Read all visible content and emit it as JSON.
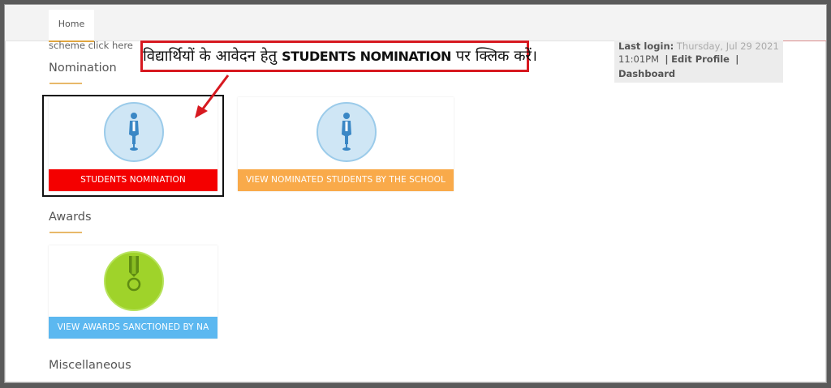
{
  "topbar": {
    "home_tab": "Home"
  },
  "scheme_text": "scheme click here",
  "sections": {
    "nomination": "Nomination",
    "awards": "Awards",
    "misc": "Miscellaneous"
  },
  "cards": {
    "students_nomination": "STUDENTS NOMINATION",
    "view_nominated": "VIEW NOMINATED STUDENTS BY THE SCHOOL",
    "view_awards": "VIEW AWARDS SANCTIONED BY NA"
  },
  "sidebar": {
    "last_login_label": "Last login:",
    "last_login_date": "Thursday, Jul 29 2021",
    "last_login_time": "11:01PM",
    "sep1": "|",
    "edit_profile": "Edit Profile",
    "sep2": "|",
    "dashboard": "Dashboard"
  },
  "callout": {
    "text_before": "विद्यार्थियों के आवेदन हेतु",
    "text_bold": "STUDENTS NOMINATION",
    "text_after": "पर क्लिक करें।"
  },
  "colors": {
    "red_bar": "#f40000",
    "orange_bar": "#f9aa4a",
    "blue_bar": "#5cb8f0",
    "callout_border": "#d71920",
    "accent_underline": "#e8b96a"
  },
  "icons": {
    "student": "student-figure-icon",
    "medal": "medal-icon",
    "arrow": "arrow-pointer-icon"
  }
}
